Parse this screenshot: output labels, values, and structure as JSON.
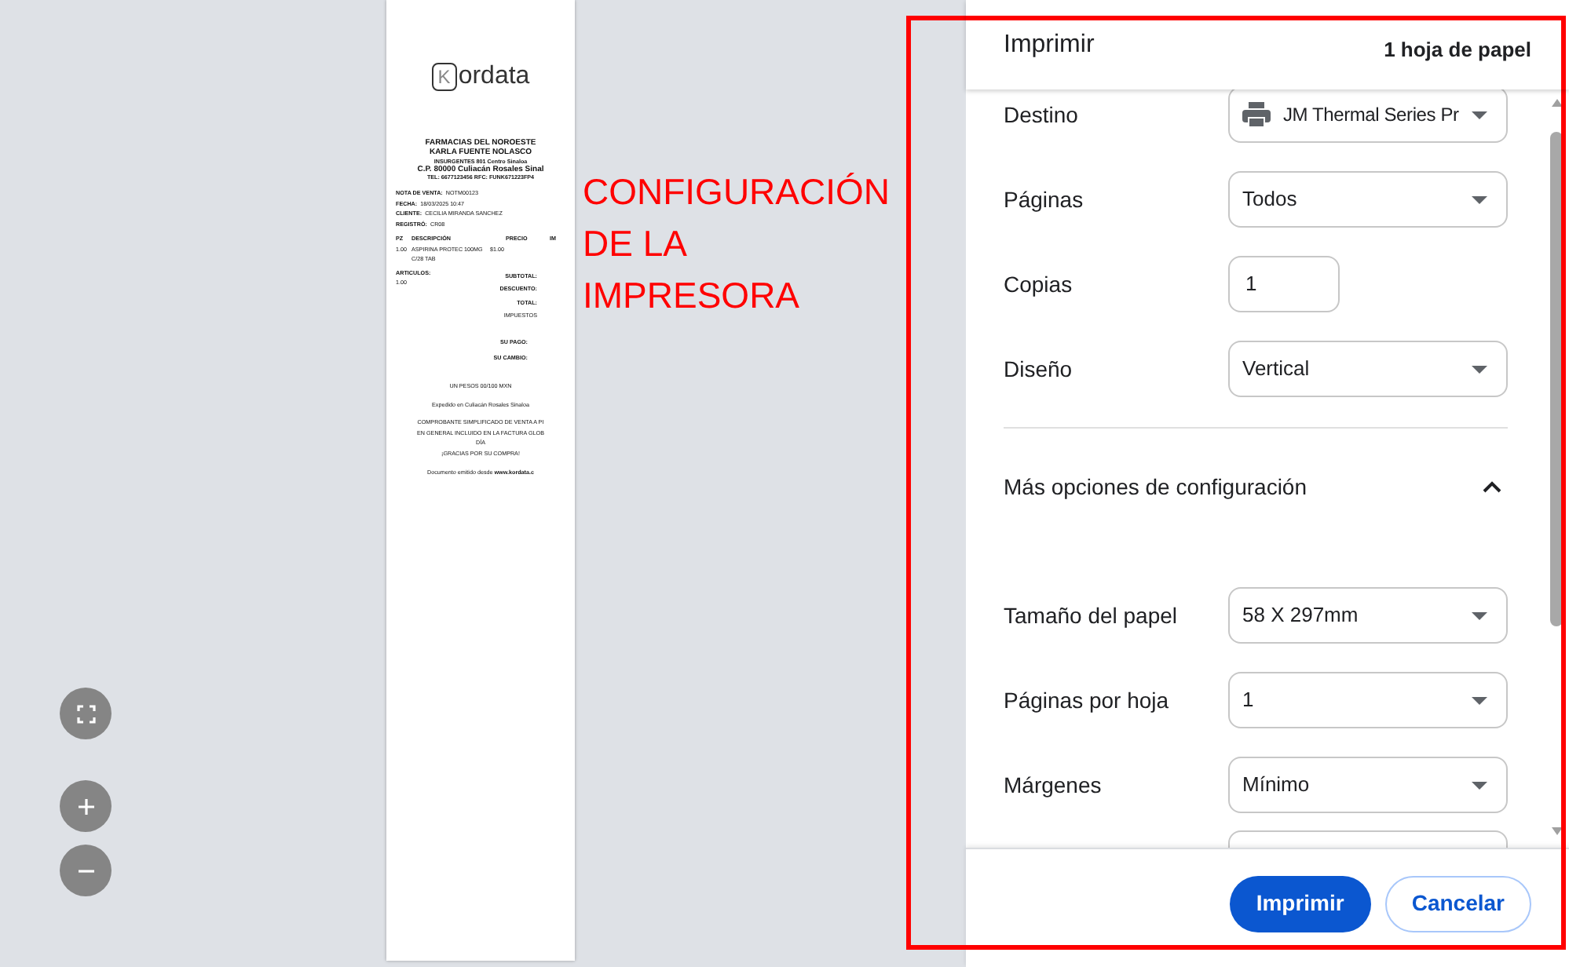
{
  "preview": {
    "logo": {
      "mark": "K",
      "text": "ordata"
    },
    "header_lines": [
      "FARMACIAS DEL NOROESTE",
      "KARLA FUENTE NOLASCO",
      "INSURGENTES 801 Centro Sinaloa",
      "C.P. 80000 Culiacán Rosales Sinal",
      "TEL: 6677123456 RFC: FUNK671223FP4"
    ],
    "info_lines": [
      {
        "label": "NOTA DE VENTA:",
        "value": "NOTM00123"
      },
      {
        "label": "FECHA:",
        "value": "18/03/2025 10:47"
      },
      {
        "label": "CLIENTE:",
        "value": "CECILIA MIRANDA SANCHEZ"
      },
      {
        "label": "REGISTRÓ:",
        "value": "CR08"
      }
    ],
    "item_columns": [
      "PZ",
      "DESCRIPCIÓN",
      "PRECIO",
      "IM"
    ],
    "items": [
      {
        "qty": "1.00",
        "description": "ASPIRINA PROTEC 100MG",
        "price": "$1.00",
        "detail": "C/28 TAB"
      }
    ],
    "articles_label": "ARTICULOS:",
    "articles_value": "1.00",
    "totals": [
      "SUBTOTAL:",
      "DESCUENTO:",
      "TOTAL:",
      "IMPUESTOS"
    ],
    "payment": [
      "SU PAGO:",
      "SU CAMBIO:"
    ],
    "footer_lines": [
      "UN PESOS 00/100 MXN",
      "Expedido en Culiacán Rosales Sinaloa",
      "COMPROBANTE SIMPLIFICADO DE VENTA A PI",
      "EN GENERAL INCLUIDO EN LA FACTURA GLOB",
      "DÍA",
      "¡GRACIAS POR SU COMPRA!"
    ],
    "footer_note": "Documento emitido desde **www.kordata.c**"
  },
  "zoom_controls": [
    {
      "kind": "fit"
    },
    {
      "kind": "zoom_in"
    },
    {
      "kind": "zoom_out"
    }
  ],
  "annotation": {
    "lines": [
      "CONFIGURACIÓN",
      "DE LA",
      "IMPRESORA"
    ]
  },
  "dialog": {
    "title": "Imprimir",
    "sheet_count": "1 hoja de papel",
    "settings": [
      {
        "label": "Destino",
        "kind": "select",
        "value": "JM Thermal Series Pr"
      },
      {
        "label": "Páginas",
        "kind": "select",
        "value": "Todos"
      },
      {
        "label": "Copias",
        "kind": "number",
        "value": "1"
      },
      {
        "label": "Diseño",
        "kind": "select",
        "value": "Vertical"
      }
    ],
    "more_options": {
      "label": "Más opciones de configuración",
      "expanded": true
    },
    "more_settings": [
      {
        "label": "Tamaño del papel",
        "kind": "select",
        "value": "58 X 297mm"
      },
      {
        "label": "Páginas por hoja",
        "kind": "select",
        "value": "1"
      },
      {
        "label": "Márgenes",
        "kind": "select",
        "value": "Mínimo"
      },
      {
        "kind": "cut"
      }
    ],
    "buttons": [
      {
        "label": "Imprimir",
        "kind": "primary"
      },
      {
        "label": "Cancelar",
        "kind": "secondary"
      }
    ]
  }
}
